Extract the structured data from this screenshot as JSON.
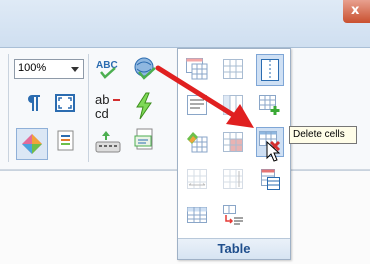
{
  "window": {
    "close_glyph": "x"
  },
  "ribbon": {
    "zoom": {
      "value": "100%"
    },
    "icons": [
      "spellcheck-abc-icon",
      "globe-check-icon",
      "paragraph-mark-icon",
      "fullscreen-icon",
      "abc-to-cd-icon",
      "lightning-icon",
      "format-painter-icon",
      "document-icon",
      "keyboard-icon",
      "insert-field-icon"
    ]
  },
  "table_panel": {
    "label": "Table",
    "accent": "#1f4e8c",
    "icons": [
      "insert-table-icon",
      "grid-icon",
      "split-cells-icon",
      "table-rows-icon",
      "insert-column-icon",
      "add-cells-icon",
      "table-style-icon",
      "merge-cells-icon",
      "delete-cells-icon",
      "table-props-icon",
      "distribute-rows-icon",
      "table-sort-icon",
      "table-grid-icon",
      "text-to-table-icon"
    ]
  },
  "tooltip": {
    "text": "Delete cells"
  },
  "annotation": {
    "arrow_color": "#e02020"
  }
}
